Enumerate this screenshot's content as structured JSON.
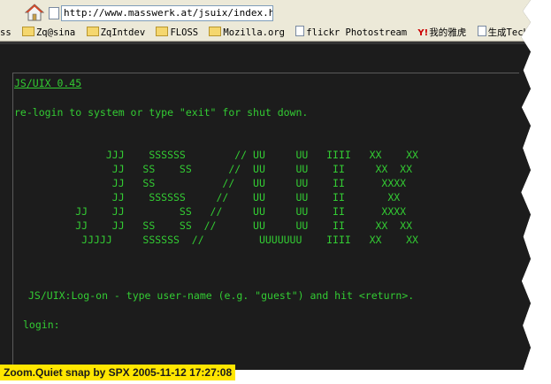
{
  "browser": {
    "url": "http://www.masswerk.at/jsuix/index.html",
    "icons": {
      "home": "home-icon",
      "page": "page-icon"
    }
  },
  "bookmarks": [
    {
      "label": "ss",
      "icon": "none"
    },
    {
      "label": "Zq@sina",
      "icon": "folder-icon"
    },
    {
      "label": "ZqIntdev",
      "icon": "folder-icon"
    },
    {
      "label": "FLOSS",
      "icon": "folder-icon"
    },
    {
      "label": "Mozilla.org",
      "icon": "folder-icon"
    },
    {
      "label": "flickr Photostream",
      "icon": "page-icon"
    },
    {
      "label": "我的雅虎",
      "icon": "yahoo-icon"
    },
    {
      "label": "生成Technorati Tag",
      "icon": "page-icon"
    }
  ],
  "terminal": {
    "title": "JS/UIX 0.45",
    "relogin": "re-login to system or type \"exit\" for shut down.",
    "art": [
      "               JJJ    SSSSSS        // UU     UU   IIII   XX    XX",
      "                JJ   SS    SS      //  UU     UU    II     XX  XX",
      "                JJ   SS           //   UU     UU    II      XXXX",
      "                JJ    SSSSSS     //    UU     UU    II       XX",
      "          JJ    JJ         SS   //     UU     UU    II      XXXX",
      "          JJ    JJ   SS    SS  //      UU     UU    II     XX  XX",
      "           JJJJJ     SSSSSS  //         UUUUUUU    IIII   XX    XX"
    ],
    "logon": "JS/UIX:Log-on - type user-name (e.g. \"guest\") and hit <return>.",
    "login_prompt": "login:"
  },
  "watermark": "Zoom.Quiet snap by SPX 2005-11-12  17:27:08",
  "colors": {
    "terminal_bg": "#1c1c1c",
    "terminal_text": "#33cc33",
    "chrome": "#ece9d8",
    "watermark_bg": "#ffe600"
  }
}
